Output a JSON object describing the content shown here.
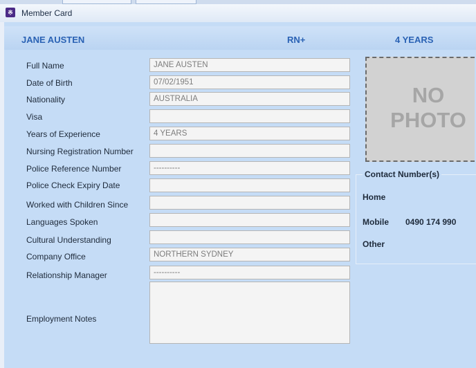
{
  "window": {
    "title": "Member Card",
    "app_icon": "people-icon"
  },
  "header": {
    "name": "JANE  AUSTEN",
    "qualification": "RN+",
    "experience": "4 YEARS"
  },
  "form": {
    "full_name": {
      "label": "Full Name",
      "value": "JANE AUSTEN"
    },
    "date_of_birth": {
      "label": "Date of Birth",
      "value": "07/02/1951"
    },
    "nationality": {
      "label": "Nationality",
      "value": "AUSTRALIA"
    },
    "visa": {
      "label": "Visa",
      "value": ""
    },
    "years_experience": {
      "label": "Years of Experience",
      "value": "4 YEARS"
    },
    "nursing_registration": {
      "label": "Nursing Registration Number",
      "value": ""
    },
    "police_reference": {
      "label": "Police Reference Number",
      "value": "----------"
    },
    "police_expiry": {
      "label": "Police Check Expiry Date",
      "value": ""
    },
    "worked_children": {
      "label": "Worked with Children Since",
      "value": ""
    },
    "languages": {
      "label": "Languages Spoken",
      "value": ""
    },
    "cultural": {
      "label": "Cultural Understanding",
      "value": ""
    },
    "company_office": {
      "label": "Company Office",
      "value": "NORTHERN SYDNEY"
    },
    "relationship_manager": {
      "label": "Relationship Manager",
      "value": "----------"
    },
    "employment_notes": {
      "label": "Employment Notes",
      "value": ""
    }
  },
  "photo": {
    "line1": "NO",
    "line2": "PHOTO"
  },
  "contact": {
    "legend": "Contact Number(s)",
    "home_label": "Home",
    "home_value": "",
    "mobile_label": "Mobile",
    "mobile_value": "0490 174 990",
    "other_label": "Other",
    "other_value": ""
  },
  "colors": {
    "header_text": "#2a62b4",
    "panel_bg": "#c5dcf6",
    "field_bg": "#f4f4f4",
    "photo_bg": "#d2d2d2"
  }
}
